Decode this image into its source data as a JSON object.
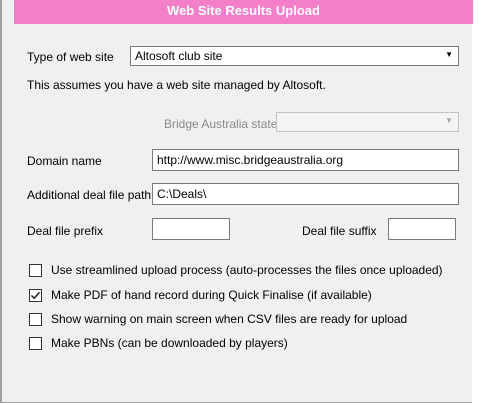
{
  "title": "Web Site Results Upload",
  "type_of_web_site": {
    "label": "Type of web site",
    "value": "Altosoft club site"
  },
  "info_text": "This assumes you have a web site managed by Altosoft.",
  "bridge_state": {
    "label": "Bridge Australia state",
    "value": ""
  },
  "domain": {
    "label": "Domain name",
    "value": "http://www.misc.bridgeaustralia.org"
  },
  "deal_path": {
    "label": "Additional deal file path",
    "value": "C:\\Deals\\"
  },
  "deal_prefix": {
    "label": "Deal file prefix",
    "value": ""
  },
  "deal_suffix": {
    "label": "Deal file suffix",
    "value": ""
  },
  "options": [
    {
      "label": "Use streamlined upload process (auto-processes the files once uploaded)",
      "checked": false
    },
    {
      "label": "Make PDF of hand record during Quick Finalise (if available)",
      "checked": true
    },
    {
      "label": "Show warning on main screen when CSV files are ready for upload",
      "checked": false
    },
    {
      "label": "Make PBNs (can be downloaded by players)",
      "checked": false
    }
  ],
  "colors": {
    "title_bar": "#f47fc9",
    "background": "#f0f0f0"
  }
}
